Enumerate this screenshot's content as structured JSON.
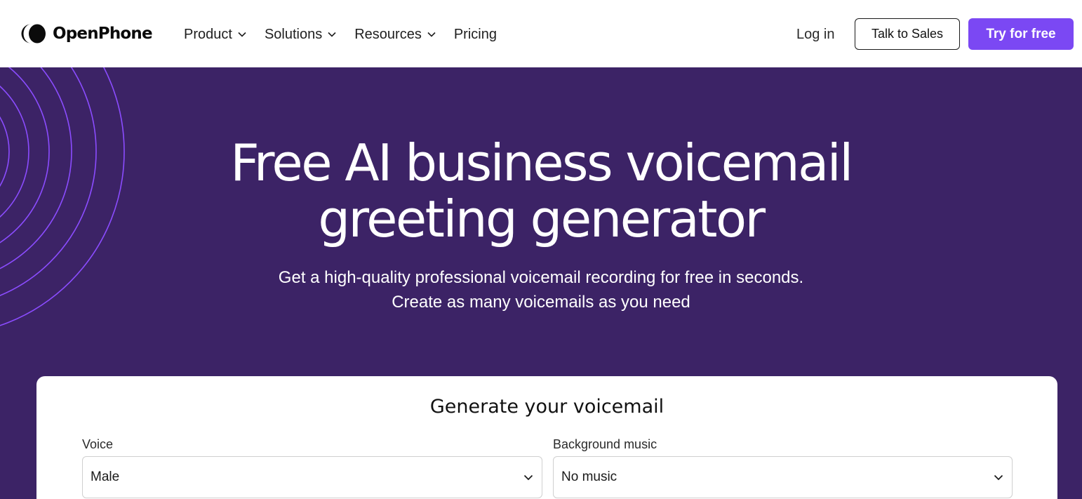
{
  "header": {
    "logo_text": "OpenPhone",
    "nav": [
      {
        "label": "Product",
        "has_dropdown": true
      },
      {
        "label": "Solutions",
        "has_dropdown": true
      },
      {
        "label": "Resources",
        "has_dropdown": true
      },
      {
        "label": "Pricing",
        "has_dropdown": false
      }
    ],
    "login_label": "Log in",
    "sales_label": "Talk to Sales",
    "try_label": "Try for free"
  },
  "hero": {
    "title_line1": "Free AI business voicemail",
    "title_line2": "greeting generator",
    "subtitle_line1": "Get a high-quality professional voicemail recording for free in seconds.",
    "subtitle_line2": "Create as many voicemails as you need"
  },
  "generator": {
    "title": "Generate your voicemail",
    "voice_label": "Voice",
    "voice_value": "Male",
    "music_label": "Background music",
    "music_value": "No music"
  },
  "colors": {
    "hero_bg": "#3c2366",
    "accent": "#7b48f3",
    "arc_stroke": "#8b4cff"
  }
}
